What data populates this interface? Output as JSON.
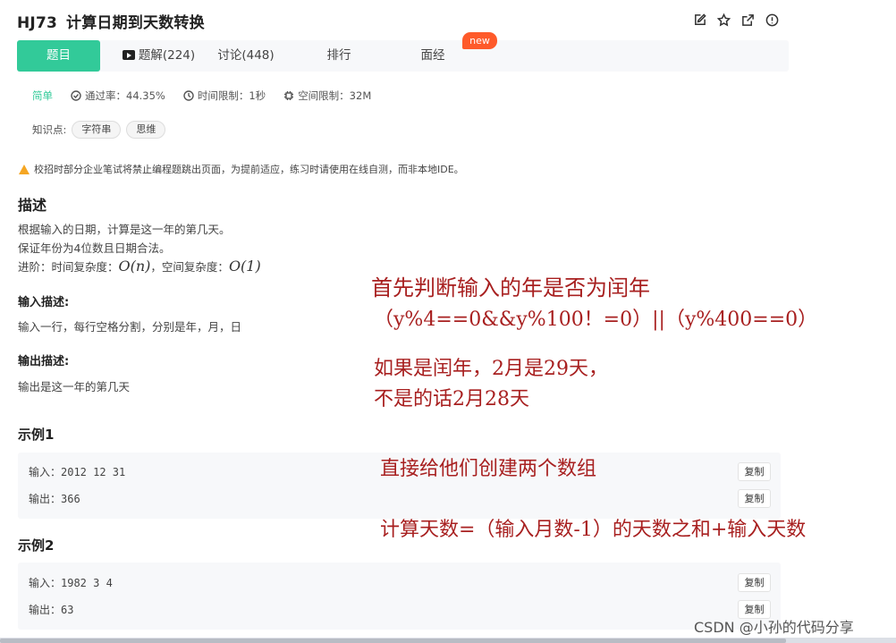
{
  "header": {
    "problem_code": "HJ73",
    "problem_title": "计算日期到天数转换",
    "icons": [
      "edit-icon",
      "star-icon",
      "share-icon",
      "info-icon"
    ]
  },
  "tabs": {
    "problem": "题目",
    "solutions": "题解(224)",
    "discuss": "讨论(448)",
    "rank": "排行",
    "interview": "面经",
    "new_badge": "new"
  },
  "meta": {
    "difficulty": "简单",
    "pass_rate": "通过率：44.35%",
    "time_limit": "时间限制：1秒",
    "space_limit": "空间限制：32M"
  },
  "knowledge": {
    "label": "知识点:",
    "tags": [
      "字符串",
      "思维"
    ]
  },
  "warning": "校招时部分企业笔试将禁止编程题跳出页面，为提前适应，练习时请使用在线自测，而非本地IDE。",
  "description": {
    "heading": "描述",
    "line1": "根据输入的日期，计算是这一年的第几天。",
    "line2": "保证年份为4位数且日期合法。",
    "line3_prefix": "进阶：时间复杂度：",
    "time_complexity": "O(n)",
    "line3_mid": "，空间复杂度：",
    "space_complexity": "O(1)"
  },
  "input_desc": {
    "heading": "输入描述:",
    "text": "输入一行，每行空格分割，分别是年，月，日"
  },
  "output_desc": {
    "heading": "输出描述:",
    "text": "输出是这一年的第几天"
  },
  "examples": [
    {
      "heading": "示例1",
      "input": "输入：2012 12 31",
      "output": "输出：366",
      "copy": "复制"
    },
    {
      "heading": "示例2",
      "input": "输入：1982 3 4",
      "output": "输出：63",
      "copy": "复制"
    }
  ],
  "annotations": {
    "line1": "首先判断输入的年是否为闰年",
    "line2": "（y%4==0&&y%100！=0）||（y%400==0）",
    "line3": "如果是闰年，2月是29天，",
    "line4": "不是的话2月28天",
    "line5": "直接给他们创建两个数组",
    "line6": "计算天数=（输入月数-1）的天数之和+输入天数"
  },
  "watermark": "CSDN @小孙的代码分享",
  "colors": {
    "accent": "#32ca99",
    "badge": "#fe5a2a",
    "annotation": "#a82020",
    "warning": "#f5a623"
  }
}
